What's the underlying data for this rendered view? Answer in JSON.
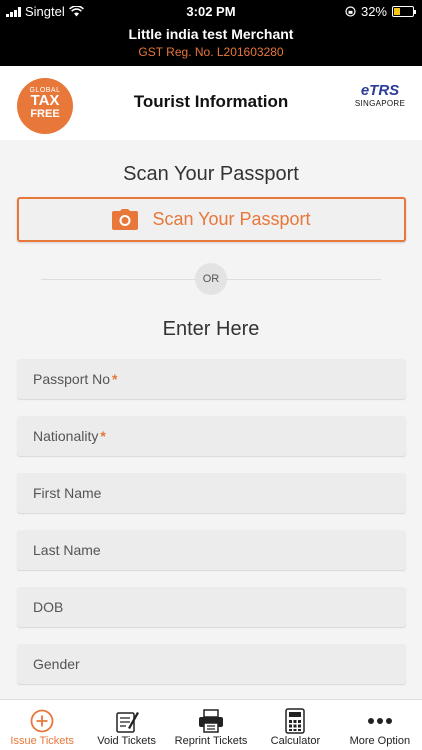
{
  "status": {
    "carrier": "Singtel",
    "time": "3:02 PM",
    "battery": "32%",
    "battery_level": 0.32
  },
  "merchant": {
    "name": "Little india test Merchant",
    "gst": "GST Reg. No. L201603280"
  },
  "header": {
    "title": "Tourist Information",
    "badge": {
      "line1": "GLOBAL",
      "line2": "TAX",
      "line3": "FREE"
    },
    "etrs_logo": "eTRS",
    "etrs_country": "SINGAPORE"
  },
  "scan": {
    "heading": "Scan Your Passport",
    "button_label": "Scan Your Passport"
  },
  "divider_label": "OR",
  "enter_heading": "Enter Here",
  "fields": [
    {
      "label": "Passport No",
      "required": "*"
    },
    {
      "label": "Nationality",
      "required": "*"
    },
    {
      "label": "First Name"
    },
    {
      "label": "Last Name"
    },
    {
      "label": "DOB"
    },
    {
      "label": "Gender"
    }
  ],
  "tabs": [
    {
      "label": "Issue Tickets",
      "icon": "plus-circle-icon",
      "active": true
    },
    {
      "label": "Void Tickets",
      "icon": "ticket-icon"
    },
    {
      "label": "Reprint Tickets",
      "icon": "printer-icon"
    },
    {
      "label": "Calculator",
      "icon": "calculator-icon"
    },
    {
      "label": "More Option",
      "icon": "more-dots-icon"
    }
  ],
  "colors": {
    "accent": "#e8773a",
    "header_bg": "#000000"
  }
}
